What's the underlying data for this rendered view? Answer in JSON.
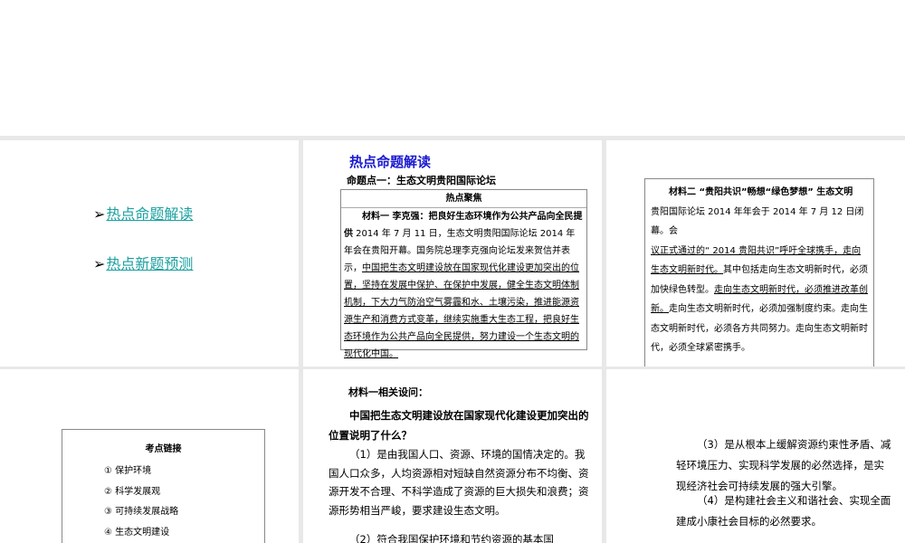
{
  "slide1": {
    "links": [
      {
        "arrow": "➢",
        "label": "热点命题解读"
      },
      {
        "arrow": "➢",
        "label": "热点新题预测"
      }
    ]
  },
  "slide2": {
    "title": "热点命题解读",
    "subtitle": "命题点一：生态文明贵阳国际论坛",
    "box_header": "热点聚焦",
    "p_lead": "材料一 李克强：把良好生态环境作为公共产品向全民提供",
    "p_plain": " 2014 年 7 月 11 日，生态文明贵阳国际论坛 2014 年年会在贵阳开幕。国务院总理李克强向论坛发来贺信并表示，",
    "p_underlined": "中国把生态文明建设放在国家现代化建设更加突出的位置，坚持在发展中保护、在保护中发展，健全生态文明体制机制，下大力气防治空气雾霾和水、土壤污染，推进能源资源生产和消费方式变革，继续实施重大生态工程，把良好生态环境作为公共产品向全民提供，努力建设一个生态文明的现代化中国。"
  },
  "slide3": {
    "lead": "材料二 “贵阳共识”畅想“绿色梦想” 生态文明",
    "t1": "贵阳国际论坛 2014 年年会于 2014 年 7 月 12 日闭幕。会",
    "u1": "议正式通过的“ 2014 贵阳共识”呼吁全球携手，走向生态文明新时代。",
    "t2": "其中包括走向生态文明新时代，必须加快绿色转型。",
    "u2": "走向生态文明新时代，必须推进改革创新。",
    "t3": "走向生态文明新时代，必须加强制度约束。走向生态文明新时代，必须各方共同努力。走向生态文明新时代，必须全球紧密携手。"
  },
  "slide4": {
    "title": "考点链接",
    "items": [
      "① 保护环境",
      "② 科学发展观",
      "③ 可持续发展战略",
      "④ 生态文明建设"
    ]
  },
  "slide5": {
    "heading": "材料一相关设问：",
    "question": "中国把生态文明建设放在国家现代化建设更加突出的位置说明了什么？",
    "a1": "（1）是由我国人口、资源、环境的国情决定的。我国人口众多，人均资源相对短缺自然资源分布不均衡、资源开发不合理、不科学造成了资源的巨大损失和浪费；资源形势相当严峻，要求建设生态文明。",
    "a2": "（2）符合我国保护环境和节约资源的基本国"
  },
  "slide6": {
    "a3": "（3）是从根本上缓解资源约束性矛盾、减轻环境压力、实现科学发展的必然选择，是实现经济社会可持续发展的强大引擎。",
    "a4": "（4）是构建社会主义和谐社会、实现全面建成小康社会目标的必然要求。"
  }
}
